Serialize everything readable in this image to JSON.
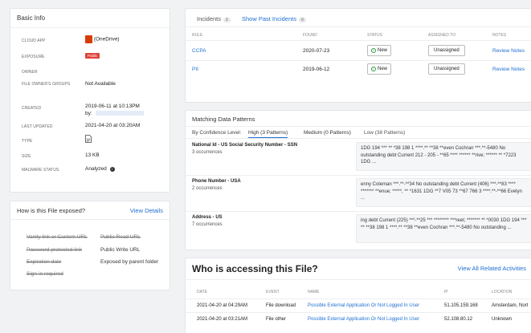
{
  "basic_info": {
    "title": "Basic Info",
    "rows": [
      {
        "label": "CLOUD APP",
        "value": "(OneDrive)"
      },
      {
        "label": "EXPOSURE",
        "value": "Public"
      },
      {
        "label": "OWNER",
        "value": ""
      },
      {
        "label": "FILE OWNER'S GROUPS",
        "value": "Not Available"
      },
      {
        "label": "CREATED",
        "value": "2019-06-11 at 10:13PM",
        "value2": "by:"
      },
      {
        "label": "LAST UPDATED",
        "value": "2021-04-20 at 03:20AM"
      },
      {
        "label": "TYPE",
        "value": ""
      },
      {
        "label": "SIZE",
        "value": "13 KB"
      },
      {
        "label": "MALWARE STATUS",
        "value": "Analyzed"
      }
    ]
  },
  "exposure": {
    "title": "How is this File exposed?",
    "link": "View Details",
    "left": [
      "Vanity link or Custom URL",
      "Password protected link",
      "Expiration date",
      "Sign-in required"
    ],
    "right": [
      "Public Read URL",
      "Public Write URL",
      "Exposed by parent folder"
    ]
  },
  "incidents": {
    "tab1": "Incidents",
    "tab1_count": "2",
    "tab2": "Show Past Incidents",
    "tab2_count": "0",
    "headers": [
      "RULE",
      "FOUND",
      "STATUS",
      "ASSIGNED TO",
      "NOTES"
    ],
    "rows": [
      {
        "rule": "CCPA",
        "found": "2020-07-23",
        "status": "New",
        "assigned": "Unassigned",
        "notes": "Review Notes"
      },
      {
        "rule": "PII",
        "found": "2019-06-12",
        "status": "New",
        "assigned": "Unassigned",
        "notes": "Review Notes"
      }
    ]
  },
  "patterns": {
    "title": "Matching Data Patterns",
    "by_label": "By Confidence Level:",
    "tabs": [
      "High (3 Patterns)",
      "Medium (0 Patterns)",
      "Low (38 Patterns)"
    ],
    "rows": [
      {
        "name": "National Id - US Social Security Number - SSN",
        "count": "3 occurrences",
        "snippet": "1DG 194 *** ** *38 198 1 ****.** **38 **even Cochran ***.**-5480 No outstanding debt Current 212 - 205 - **65 **** ****** **rive; ****** ** *7223 1DG ..."
      },
      {
        "name": "Phone Number - USA",
        "count": "2 occurrences",
        "snippet": "enny Coleman ***.**-**34 No outstanding debt Current (406) ***-**83 **** ******* **enue; *****, ** *1631 1DG **7 V05 73 **67 766 3 ****.**-**66 Evelyn ..."
      },
      {
        "name": "Address - US",
        "count": "7 occurrences",
        "snippet": "ing debt Current (225) ***-**25 *** ******** ***reet; ******* ** *0030 1DG 194 *** ** **38 198 1 ****.** **38 **even Cochran ***.**-5480 No outstanding ..."
      }
    ]
  },
  "access": {
    "title": "Who is accessing this File?",
    "link": "View All Related Activities",
    "headers": [
      "DATE",
      "EVENT",
      "NAME",
      "IP",
      "LOCATION"
    ],
    "rows": [
      {
        "date": "2021-04-20 at 04:29AM",
        "event": "File download",
        "name": "Possible External Application Or Not Logged In User",
        "ip": "51.105.159.168",
        "location": "Amsterdam, Nort"
      },
      {
        "date": "2021-04-20 at 03:21AM",
        "event": "File other",
        "name": "Possible External Application Or Not Logged In User",
        "ip": "52.108.80.12",
        "location": "Unknown"
      }
    ]
  }
}
